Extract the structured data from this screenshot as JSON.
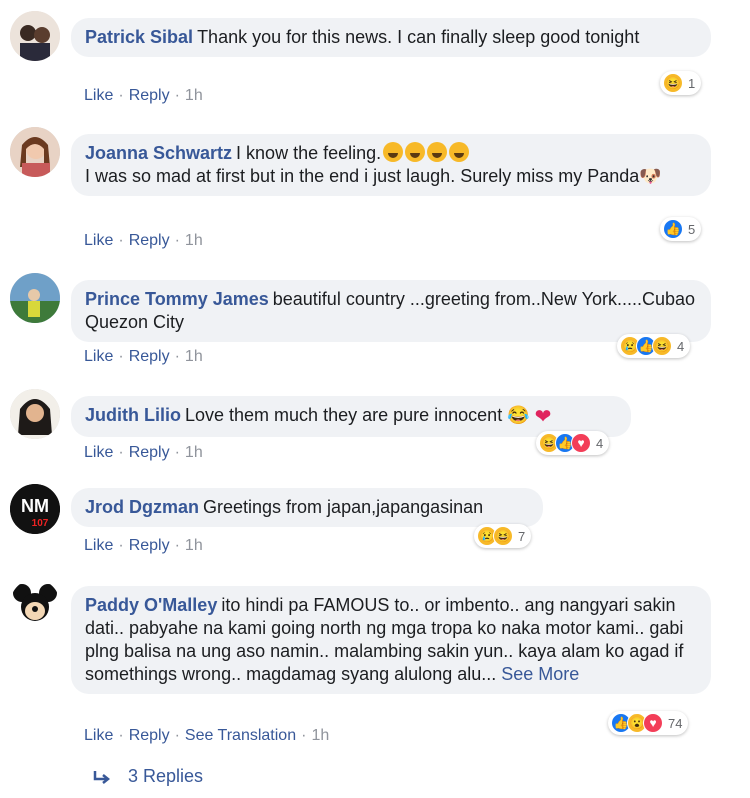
{
  "comments": [
    {
      "author": "Patrick Sibal",
      "text": "Thank you for this news. I can finally sleep good tonight",
      "actions": {
        "like": "Like",
        "reply": "Reply",
        "time": "1h"
      },
      "reactions": {
        "icons": [
          "haha"
        ],
        "count": "1"
      }
    },
    {
      "author": "Joanna Schwartz",
      "text": "I know the feeling.",
      "text2": "I was so mad at first but in the end i just laugh. Surely miss my Panda",
      "actions": {
        "like": "Like",
        "reply": "Reply",
        "time": "1h"
      },
      "reactions": {
        "icons": [
          "like"
        ],
        "count": "5"
      }
    },
    {
      "author": "Prince Tommy James",
      "text": "beautiful country ...greeting from..New York.....Cubao Quezon City",
      "actions": {
        "like": "Like",
        "reply": "Reply",
        "time": "1h"
      },
      "reactions": {
        "icons": [
          "sad",
          "like",
          "haha"
        ],
        "count": "4"
      }
    },
    {
      "author": "Judith Lilio",
      "text": "Love them much they are pure innocent",
      "actions": {
        "like": "Like",
        "reply": "Reply",
        "time": "1h"
      },
      "reactions": {
        "icons": [
          "haha",
          "like",
          "love"
        ],
        "count": "4"
      }
    },
    {
      "author": "Jrod Dgzman",
      "text": "Greetings from japan,japangasinan",
      "actions": {
        "like": "Like",
        "reply": "Reply",
        "time": "1h"
      },
      "reactions": {
        "icons": [
          "sad",
          "haha"
        ],
        "count": "7"
      }
    },
    {
      "author": "Paddy O'Malley",
      "text": "ito hindi pa FAMOUS to.. or imbento.. ang nangyari sakin dati.. pabyahe na kami going north ng mga tropa ko naka motor kami.. gabi plng balisa na ung aso namin.. malambing sakin yun.. kaya alam ko agad if somethings wrong.. magdamag syang alulong alu...",
      "see_more": "See More",
      "actions": {
        "like": "Like",
        "reply": "Reply",
        "translate": "See Translation",
        "time": "1h"
      },
      "reactions": {
        "icons": [
          "like",
          "wow",
          "love"
        ],
        "count": "74"
      }
    }
  ],
  "replies_link": "3 Replies"
}
